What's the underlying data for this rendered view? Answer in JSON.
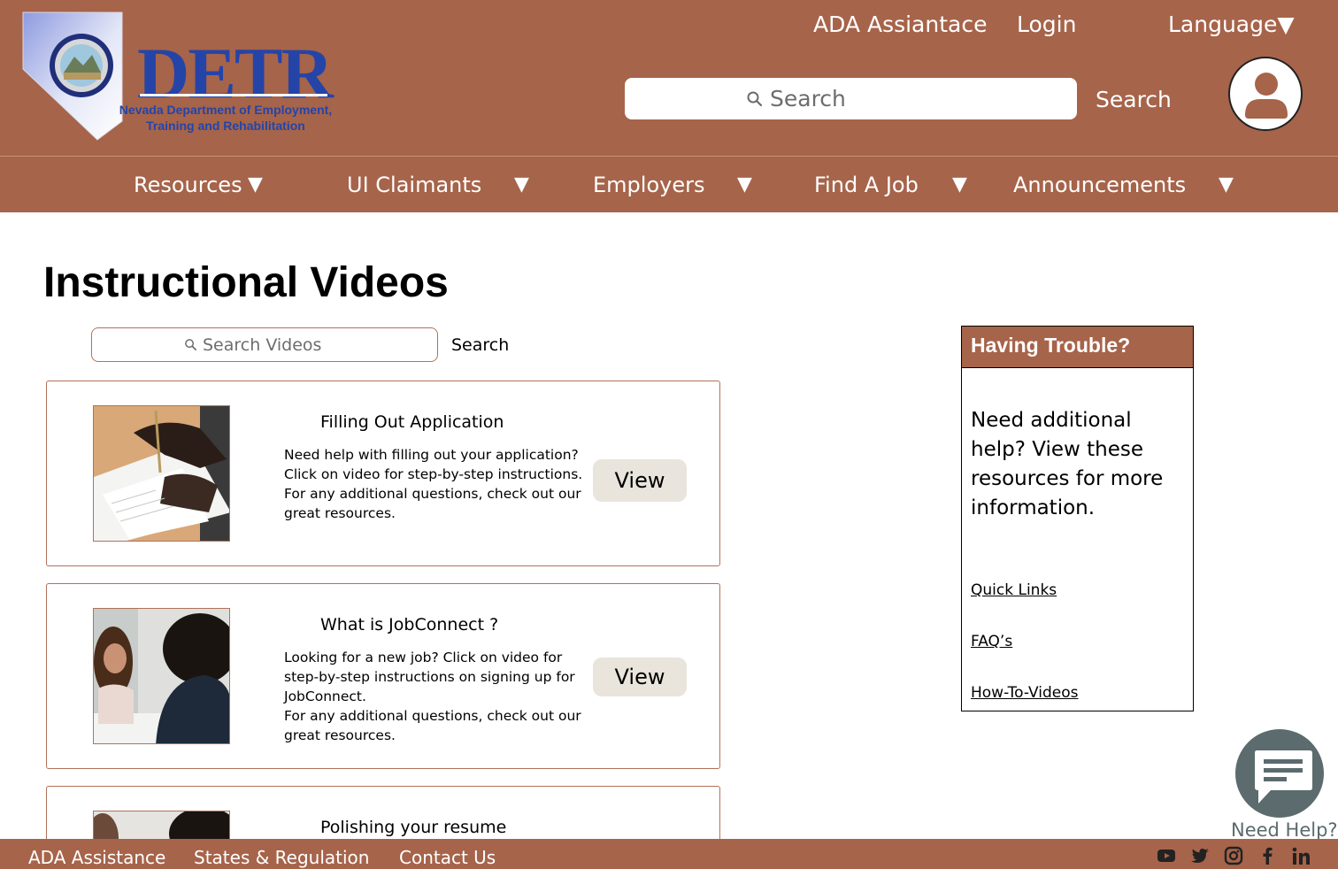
{
  "header": {
    "logo": {
      "wordmark": "DETR",
      "subtitle_line1": "Nevada Department of Employment,",
      "subtitle_line2": "Training and Rehabilitation"
    },
    "top_links": {
      "ada": "ADA Assiantace",
      "login": "Login",
      "language": "Language▼"
    },
    "search": {
      "placeholder": "Search",
      "button": "Search"
    },
    "avatar_icon": "user-circle-icon"
  },
  "nav": {
    "items": [
      {
        "label": "Resources"
      },
      {
        "label": "UI Claimants"
      },
      {
        "label": "Employers"
      },
      {
        "label": "Find A Job"
      },
      {
        "label": "Announcements"
      }
    ],
    "caret": "▼"
  },
  "main": {
    "title": "Instructional Videos",
    "video_search": {
      "placeholder": "Search Videos",
      "button": "Search"
    },
    "videos": [
      {
        "title": "Filling Out Application",
        "description": "Need help with filling out your application? Click on video for step-by-step instructions. For any additional questions, check out our great resources.",
        "button": "View"
      },
      {
        "title": "What is JobConnect ?",
        "description_line1": "Looking for a new job? Click on video for step-by-step instructions on signing up for JobConnect.",
        "description_line2": "For any additional questions, check out our great resources.",
        "button": "View"
      },
      {
        "title": "Polishing your resume"
      }
    ]
  },
  "trouble_panel": {
    "heading": "Having Trouble?",
    "text": "Need additional help? View these resources for more information.",
    "links": [
      "Quick Links",
      "FAQ’s",
      "How-To-Videos"
    ]
  },
  "help_widget": {
    "label": "Need Help?",
    "icon": "chat-bubble-icon"
  },
  "footer": {
    "links": [
      "ADA Assistance",
      "States & Regulation",
      "Contact Us"
    ],
    "social_icons": [
      "youtube-icon",
      "twitter-icon",
      "instagram-icon",
      "facebook-icon",
      "linkedin-icon"
    ]
  },
  "colors": {
    "brand_brown": "#a6644a",
    "logo_blue": "#2544a8",
    "button_bg": "#e9e5dc",
    "help_gray": "#5b6b6e"
  }
}
